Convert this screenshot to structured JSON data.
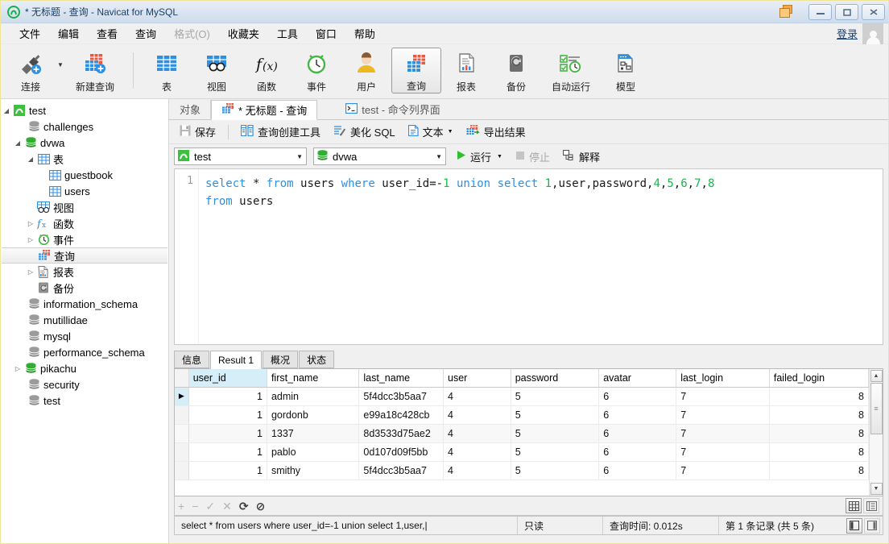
{
  "window": {
    "title": "* 无标题 - 查询 - Navicat for MySQL",
    "logo_icon": "navicat-logo-icon",
    "app_icon": "cascade-windows-icon",
    "minimize_label": "最小化",
    "maximize_label": "最大化",
    "close_label": "关闭"
  },
  "menubar": {
    "items": [
      {
        "label": "文件",
        "disabled": false
      },
      {
        "label": "编辑",
        "disabled": false
      },
      {
        "label": "查看",
        "disabled": false
      },
      {
        "label": "查询",
        "disabled": false
      },
      {
        "label": "格式(O)",
        "disabled": true
      },
      {
        "label": "收藏夹",
        "disabled": false
      },
      {
        "label": "工具",
        "disabled": false
      },
      {
        "label": "窗口",
        "disabled": false
      },
      {
        "label": "帮助",
        "disabled": false
      }
    ],
    "login_label": "登录",
    "avatar_icon": "user-avatar-icon"
  },
  "ribbon": {
    "items": [
      {
        "label": "连接",
        "icon": "connection-plug-icon",
        "active": false
      },
      {
        "label": "新建查询",
        "icon": "new-query-icon",
        "active": false
      },
      {
        "label": "表",
        "icon": "table-icon",
        "active": false
      },
      {
        "label": "视图",
        "icon": "view-icon",
        "active": false
      },
      {
        "label": "函数",
        "icon": "function-fx-icon",
        "active": false
      },
      {
        "label": "事件",
        "icon": "event-clock-icon",
        "active": false
      },
      {
        "label": "用户",
        "icon": "user-icon",
        "active": false
      },
      {
        "label": "查询",
        "icon": "query-icon",
        "active": true
      },
      {
        "label": "报表",
        "icon": "report-icon",
        "active": false
      },
      {
        "label": "备份",
        "icon": "backup-icon",
        "active": false
      },
      {
        "label": "自动运行",
        "icon": "automation-icon",
        "active": false
      },
      {
        "label": "模型",
        "icon": "model-icon",
        "active": false
      }
    ]
  },
  "sidebar": {
    "nodes": [
      {
        "label": "test",
        "icon": "connection-icon",
        "indent": 0,
        "twist": "expanded",
        "selected": false
      },
      {
        "label": "challenges",
        "icon": "database-gray-icon",
        "indent": 1,
        "twist": "none",
        "selected": false
      },
      {
        "label": "dvwa",
        "icon": "database-green-icon",
        "indent": 1,
        "twist": "expanded",
        "selected": false
      },
      {
        "label": "表",
        "icon": "table-folder-icon",
        "indent": 2,
        "twist": "expanded",
        "selected": false
      },
      {
        "label": "guestbook",
        "icon": "table-icon",
        "indent": 3,
        "twist": "none",
        "selected": false
      },
      {
        "label": "users",
        "icon": "table-icon",
        "indent": 3,
        "twist": "none",
        "selected": false
      },
      {
        "label": "视图",
        "icon": "view-folder-icon",
        "indent": 2,
        "twist": "none",
        "selected": false
      },
      {
        "label": "函数",
        "icon": "function-fx-icon",
        "indent": 2,
        "twist": "collapsed",
        "selected": false
      },
      {
        "label": "事件",
        "icon": "event-clock-icon",
        "indent": 2,
        "twist": "collapsed",
        "selected": false
      },
      {
        "label": "查询",
        "icon": "query-icon",
        "indent": 2,
        "twist": "none",
        "selected": true
      },
      {
        "label": "报表",
        "icon": "report-icon",
        "indent": 2,
        "twist": "collapsed",
        "selected": false
      },
      {
        "label": "备份",
        "icon": "backup-icon",
        "indent": 2,
        "twist": "none",
        "selected": false
      },
      {
        "label": "information_schema",
        "icon": "database-gray-icon",
        "indent": 1,
        "twist": "none",
        "selected": false
      },
      {
        "label": "mutillidae",
        "icon": "database-gray-icon",
        "indent": 1,
        "twist": "none",
        "selected": false
      },
      {
        "label": "mysql",
        "icon": "database-gray-icon",
        "indent": 1,
        "twist": "none",
        "selected": false
      },
      {
        "label": "performance_schema",
        "icon": "database-gray-icon",
        "indent": 1,
        "twist": "none",
        "selected": false
      },
      {
        "label": "pikachu",
        "icon": "database-green-icon",
        "indent": 1,
        "twist": "collapsed",
        "selected": false
      },
      {
        "label": "security",
        "icon": "database-gray-icon",
        "indent": 1,
        "twist": "none",
        "selected": false
      },
      {
        "label": "test",
        "icon": "database-gray-icon",
        "indent": 1,
        "twist": "none",
        "selected": false
      }
    ]
  },
  "doctabs": [
    {
      "label": "对象",
      "icon": "",
      "active": false
    },
    {
      "label": "* 无标题 - 查询",
      "icon": "query-icon",
      "active": true
    },
    {
      "label": "test - 命令列界面",
      "icon": "console-icon",
      "active": false
    }
  ],
  "querybar": {
    "buttons": [
      {
        "label": "保存",
        "icon": "save-icon"
      },
      {
        "label": "查询创建工具",
        "icon": "query-builder-icon"
      },
      {
        "label": "美化 SQL",
        "icon": "beautify-sql-icon"
      },
      {
        "label": "文本",
        "icon": "text-icon",
        "caret": true
      },
      {
        "label": "导出结果",
        "icon": "export-result-icon"
      }
    ]
  },
  "connectionbar": {
    "connection": {
      "value": "test",
      "icon": "connection-icon"
    },
    "database": {
      "value": "dvwa",
      "icon": "database-green-icon"
    },
    "run_label": "运行",
    "stop_label": "停止",
    "explain_label": "解释",
    "run_icon": "play-icon",
    "stop_icon": "stop-icon",
    "explain_icon": "explain-icon"
  },
  "editor": {
    "line_number": "1",
    "tokens": [
      {
        "t": "select",
        "c": "k"
      },
      {
        "t": " ",
        "c": "p"
      },
      {
        "t": "*",
        "c": "p"
      },
      {
        "t": " ",
        "c": "p"
      },
      {
        "t": "from",
        "c": "k"
      },
      {
        "t": " ",
        "c": "p"
      },
      {
        "t": "users",
        "c": "p"
      },
      {
        "t": " ",
        "c": "p"
      },
      {
        "t": "where",
        "c": "k"
      },
      {
        "t": " ",
        "c": "p"
      },
      {
        "t": "user_id=-",
        "c": "p"
      },
      {
        "t": "1",
        "c": "n"
      },
      {
        "t": " ",
        "c": "p"
      },
      {
        "t": "union",
        "c": "k"
      },
      {
        "t": " ",
        "c": "p"
      },
      {
        "t": "select",
        "c": "k"
      },
      {
        "t": " ",
        "c": "p"
      },
      {
        "t": "1",
        "c": "n"
      },
      {
        "t": ",user,password,",
        "c": "p"
      },
      {
        "t": "4",
        "c": "n"
      },
      {
        "t": ",",
        "c": "p"
      },
      {
        "t": "5",
        "c": "n"
      },
      {
        "t": ",",
        "c": "p"
      },
      {
        "t": "6",
        "c": "n"
      },
      {
        "t": ",",
        "c": "p"
      },
      {
        "t": "7",
        "c": "n"
      },
      {
        "t": ",",
        "c": "p"
      },
      {
        "t": "8",
        "c": "n"
      },
      {
        "t": "\n",
        "c": "p"
      },
      {
        "t": "from",
        "c": "k"
      },
      {
        "t": " ",
        "c": "p"
      },
      {
        "t": "users",
        "c": "p"
      }
    ],
    "plain_sql": "select * from users where user_id=-1 union select 1,user,password,4,5,6,7,8 from users"
  },
  "resulttabs": [
    {
      "label": "信息",
      "active": false
    },
    {
      "label": "Result 1",
      "active": true
    },
    {
      "label": "概况",
      "active": false
    },
    {
      "label": "状态",
      "active": false
    }
  ],
  "grid": {
    "columns": [
      "user_id",
      "first_name",
      "last_name",
      "user",
      "password",
      "avatar",
      "last_login",
      "failed_login"
    ],
    "rows": [
      {
        "marker": "▶",
        "current": true,
        "cells": [
          "1",
          "admin",
          "5f4dcc3b5aa7",
          "4",
          "5",
          "6",
          "7",
          "8"
        ]
      },
      {
        "marker": "",
        "current": false,
        "cells": [
          "1",
          "gordonb",
          "e99a18c428cb",
          "4",
          "5",
          "6",
          "7",
          "8"
        ]
      },
      {
        "marker": "",
        "current": false,
        "cells": [
          "1",
          "1337",
          "8d3533d75ae2",
          "4",
          "5",
          "6",
          "7",
          "8"
        ]
      },
      {
        "marker": "",
        "current": false,
        "cells": [
          "1",
          "pablo",
          "0d107d09f5bb",
          "4",
          "5",
          "6",
          "7",
          "8"
        ]
      },
      {
        "marker": "",
        "current": false,
        "cells": [
          "1",
          "smithy",
          "5f4dcc3b5aa7",
          "4",
          "5",
          "6",
          "7",
          "8"
        ]
      }
    ],
    "scroll_up_icon": "scroll-up-arrow-icon",
    "scroll_down_icon": "scroll-down-arrow-icon"
  },
  "gridfooter": {
    "icons": [
      {
        "name": "add-record-icon",
        "glyph": "+",
        "enabled": false
      },
      {
        "name": "remove-record-icon",
        "glyph": "−",
        "enabled": false
      },
      {
        "name": "apply-change-icon",
        "glyph": "✓",
        "enabled": false
      },
      {
        "name": "cancel-change-icon",
        "glyph": "✕",
        "enabled": false
      },
      {
        "name": "refresh-icon",
        "glyph": "⟳",
        "enabled": true
      },
      {
        "name": "stop-loading-icon",
        "glyph": "⊘",
        "enabled": true
      }
    ],
    "view_grid_icon": "grid-view-icon",
    "view_form_icon": "form-view-icon"
  },
  "statusbar": {
    "sql_text": "select * from users where user_id=-1 union select 1,user,|",
    "readonly_label": "只读",
    "query_time_label": "查询时间: 0.012s",
    "record_label": "第 1 条记录 (共 5 条)",
    "panel_left_icon": "panel-left-icon",
    "panel_right_icon": "panel-right-icon"
  },
  "colors": {
    "accent_blue": "#2f8fe0",
    "number_green": "#14b84b",
    "brand_green": "#3fbf3f",
    "header_highlight": "#d6eef8",
    "titlebar": "#dbe5f1",
    "chrome": "#f0f0f0"
  }
}
